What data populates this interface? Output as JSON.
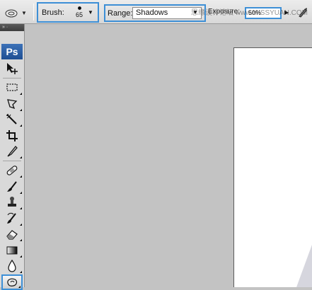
{
  "options_bar": {
    "tool_preset_icon": "sponge-tool-icon",
    "brush": {
      "label": "Brush:",
      "size": "65"
    },
    "range": {
      "label": "Range:",
      "value": "Shadows"
    },
    "exposure": {
      "label": "Exposure:",
      "value": "50%"
    },
    "airbrush_icon": "airbrush-icon"
  },
  "toolbox": {
    "logo": "Ps",
    "tools": [
      {
        "name": "move-tool",
        "icon": "move-icon"
      },
      {
        "name": "marquee-tool",
        "icon": "marquee-icon"
      },
      {
        "name": "lasso-tool",
        "icon": "lasso-icon"
      },
      {
        "name": "magic-wand-tool",
        "icon": "magic-wand-icon"
      },
      {
        "name": "crop-tool",
        "icon": "crop-icon"
      },
      {
        "name": "slice-tool",
        "icon": "slice-icon"
      },
      {
        "name": "healing-brush-tool",
        "icon": "bandage-icon"
      },
      {
        "name": "brush-tool",
        "icon": "brush-icon"
      },
      {
        "name": "clone-stamp-tool",
        "icon": "stamp-icon"
      },
      {
        "name": "history-brush-tool",
        "icon": "history-brush-icon"
      },
      {
        "name": "eraser-tool",
        "icon": "eraser-icon"
      },
      {
        "name": "gradient-tool",
        "icon": "gradient-icon"
      },
      {
        "name": "blur-tool",
        "icon": "blur-icon"
      },
      {
        "name": "sponge-tool",
        "icon": "sponge-icon"
      }
    ],
    "active_tool": "sponge-tool"
  },
  "watermark": "思缘设计论坛 www.MISSYUAN.COM",
  "colors": {
    "highlight": "#3d8fd6",
    "workspace": "#c3c3c3",
    "document": "#ffffff"
  }
}
